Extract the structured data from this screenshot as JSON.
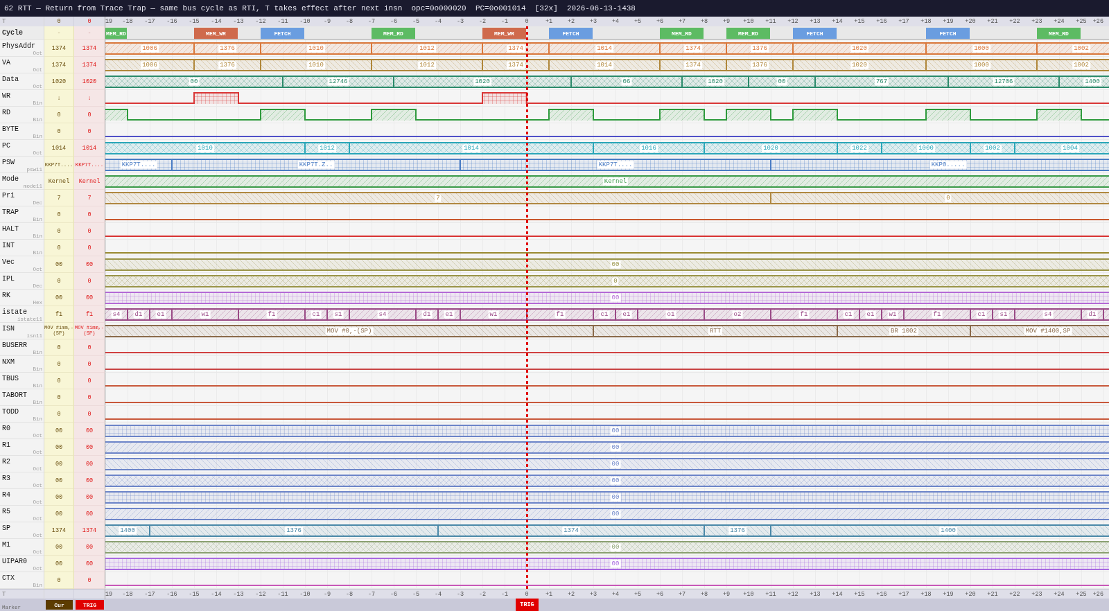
{
  "window": {
    "title": "62 RTT — Return from Trace Trap — same bus cycle as RTI, T takes effect after next insn  opc=0o000020  PC=0o001014  [32x]  2026-06-13-1438"
  },
  "top_axis": {
    "label": "T",
    "cursor_time": "0",
    "trigger_time": "0",
    "ticks": [
      "19",
      "-18",
      "-17",
      "-16",
      "-15",
      "-14",
      "-13",
      "-12",
      "-11",
      "-10",
      "-9",
      "-8",
      "-7",
      "-6",
      "-5",
      "-4",
      "-3",
      "-2",
      "-1",
      "0",
      "+1",
      "+2",
      "+3",
      "+4",
      "+5",
      "+6",
      "+7",
      "+8",
      "+9",
      "+10",
      "+11",
      "+12",
      "+13",
      "+14",
      "+15",
      "+16",
      "+17",
      "+18",
      "+19",
      "+20",
      "+21",
      "+22",
      "+23",
      "+24",
      "+25",
      "+26"
    ]
  },
  "cycle_row": {
    "label": "Cycle",
    "cursor_value": "-",
    "trigger_value": "-",
    "cycles": [
      {
        "label": "MEM_RD",
        "color": "#5dbb63"
      },
      {
        "label": "MEM_WR",
        "color": "#cf6a4c"
      },
      {
        "label": "FETCH",
        "color": "#6a9de0"
      },
      {
        "label": "MEM_RD",
        "color": "#5dbb63"
      },
      {
        "label": "MEM_WR",
        "color": "#cf6a4c"
      },
      {
        "label": "FETCH",
        "color": "#6a9de0"
      },
      {
        "label": "MEM_RD",
        "color": "#5dbb63"
      },
      {
        "label": "MEM_RD",
        "color": "#5dbb63"
      },
      {
        "label": "FETCH",
        "color": "#6a9de0"
      },
      {
        "label": "FETCH",
        "color": "#6a9de0"
      },
      {
        "label": "MEM_RD",
        "color": "#5dbb63"
      }
    ]
  },
  "signals": [
    {
      "name": "PhysAddr",
      "radix": "Oct",
      "kind": "bus",
      "color": "#d9773a",
      "cursor_value": "1374",
      "trigger_value": "1374",
      "segments": [
        {
          "value": "1006"
        },
        {
          "value": "1376"
        },
        {
          "value": "1010"
        },
        {
          "value": "1012"
        },
        {
          "value": "1374"
        },
        {
          "value": "1014"
        },
        {
          "value": "1374"
        },
        {
          "value": "1376"
        },
        {
          "value": "1020"
        },
        {
          "value": "1000"
        },
        {
          "value": "1002"
        }
      ]
    },
    {
      "name": "VA",
      "radix": "Oct",
      "kind": "bus",
      "color": "#b0873a",
      "cursor_value": "1374",
      "trigger_value": "1374",
      "segments": [
        {
          "value": "1006"
        },
        {
          "value": "1376"
        },
        {
          "value": "1010"
        },
        {
          "value": "1012"
        },
        {
          "value": "1374"
        },
        {
          "value": "1014"
        },
        {
          "value": "1374"
        },
        {
          "value": "1376"
        },
        {
          "value": "1020"
        },
        {
          "value": "1000"
        },
        {
          "value": "1002"
        }
      ]
    },
    {
      "name": "Data",
      "radix": "Oct",
      "kind": "bus",
      "color": "#2a8a6a",
      "cursor_value": "1020",
      "trigger_value": "1020",
      "segments": [
        {
          "value": "00"
        },
        {
          "value": "12746"
        },
        {
          "value": "1020"
        },
        {
          "value": "06"
        },
        {
          "value": "1020"
        },
        {
          "value": "00"
        },
        {
          "value": "767"
        },
        {
          "value": "12706"
        },
        {
          "value": "1400"
        }
      ]
    },
    {
      "name": "WR",
      "radix": "Bin",
      "kind": "bit",
      "color": "#d93636",
      "cursor_value": "↓",
      "trigger_value": "↓",
      "segments": [
        {
          "high": false
        },
        {
          "high": true
        },
        {
          "high": false
        },
        {
          "high": true
        },
        {
          "high": false
        }
      ]
    },
    {
      "name": "RD",
      "radix": "Bin",
      "kind": "bit",
      "color": "#2e9a3c",
      "cursor_value": "0",
      "trigger_value": "0",
      "segments": [
        {
          "high": true
        },
        {
          "high": false
        },
        {
          "high": true
        },
        {
          "high": false
        },
        {
          "high": true
        },
        {
          "high": false
        },
        {
          "high": true
        },
        {
          "high": false
        },
        {
          "high": true
        },
        {
          "high": false
        },
        {
          "high": true
        },
        {
          "high": false
        },
        {
          "high": true
        },
        {
          "high": false
        },
        {
          "high": true
        },
        {
          "high": false
        },
        {
          "high": true
        },
        {
          "high": false
        }
      ]
    },
    {
      "name": "BYTE",
      "radix": "Bin",
      "kind": "bit",
      "color": "#5050c8",
      "cursor_value": "0",
      "trigger_value": "0",
      "segments": [
        {
          "high": false
        }
      ]
    },
    {
      "name": "PC",
      "radix": "Oct",
      "kind": "bus",
      "color": "#2aa6b8",
      "cursor_value": "1014",
      "trigger_value": "1014",
      "segments": [
        {
          "value": "1010"
        },
        {
          "value": "1012"
        },
        {
          "value": "1014"
        },
        {
          "value": "1016"
        },
        {
          "value": "1020"
        },
        {
          "value": "1022"
        },
        {
          "value": "1000"
        },
        {
          "value": "1002"
        },
        {
          "value": "1004"
        }
      ]
    },
    {
      "name": "PSW",
      "radix": "psw11",
      "kind": "bus",
      "color": "#4a7cc4",
      "cursor_value": "KKP7T....",
      "trigger_value": "KKP7T....",
      "segments": [
        {
          "value": "KKP7T...."
        },
        {
          "value": "KKP7T.Z.."
        },
        {
          "value": "KKP7T...."
        },
        {
          "value": "KKP0....."
        }
      ]
    },
    {
      "name": "Mode",
      "radix": "mode11",
      "kind": "bus",
      "color": "#3a9a48",
      "cursor_value": "Kernel",
      "trigger_value": "Kernel",
      "segments": [
        {
          "value": "Kernel"
        }
      ]
    },
    {
      "name": "Pri",
      "radix": "Dec",
      "kind": "bus",
      "color": "#b08840",
      "cursor_value": "7",
      "trigger_value": "7",
      "segments": [
        {
          "value": "7"
        },
        {
          "value": "0"
        }
      ]
    },
    {
      "name": "TRAP",
      "radix": "Bin",
      "kind": "bit",
      "color": "#c8582e",
      "cursor_value": "0",
      "trigger_value": "0",
      "segments": [
        {
          "high": false
        }
      ]
    },
    {
      "name": "HALT",
      "radix": "Bin",
      "kind": "bit",
      "color": "#d83232",
      "cursor_value": "0",
      "trigger_value": "0",
      "segments": [
        {
          "high": false
        }
      ]
    },
    {
      "name": "INT",
      "radix": "Bin",
      "kind": "bit",
      "color": "#9a8a30",
      "cursor_value": "0",
      "trigger_value": "0",
      "segments": [
        {
          "high": false
        }
      ]
    },
    {
      "name": "Vec",
      "radix": "Oct",
      "kind": "bus",
      "color": "#9a9448",
      "cursor_value": "00",
      "trigger_value": "00",
      "segments": [
        {
          "value": "00"
        }
      ]
    },
    {
      "name": "IPL",
      "radix": "Dec",
      "kind": "bus",
      "color": "#9a9448",
      "cursor_value": "0",
      "trigger_value": "0",
      "segments": [
        {
          "value": "0"
        }
      ]
    },
    {
      "name": "RK",
      "radix": "Hex",
      "kind": "bus",
      "color": "#b46ad6",
      "cursor_value": "00",
      "trigger_value": "00",
      "segments": [
        {
          "value": "00"
        }
      ]
    },
    {
      "name": "istate",
      "radix": "istate11",
      "kind": "bus",
      "color": "#9a4a86",
      "cursor_value": "f1",
      "trigger_value": "f1",
      "segments": [
        {
          "value": "s4"
        },
        {
          "value": "d1"
        },
        {
          "value": "e1"
        },
        {
          "value": "w1"
        },
        {
          "value": "f1"
        },
        {
          "value": "c1"
        },
        {
          "value": "s1"
        },
        {
          "value": "s4"
        },
        {
          "value": "d1"
        },
        {
          "value": "e1"
        },
        {
          "value": "w1"
        },
        {
          "value": "f1"
        },
        {
          "value": "c1"
        },
        {
          "value": "e1"
        },
        {
          "value": "o1"
        },
        {
          "value": "o2"
        },
        {
          "value": "f1"
        },
        {
          "value": "c1"
        },
        {
          "value": "e1"
        },
        {
          "value": "w1"
        },
        {
          "value": "f1"
        },
        {
          "value": "c1"
        },
        {
          "value": "s1"
        },
        {
          "value": "s4"
        },
        {
          "value": "d1"
        }
      ]
    },
    {
      "name": "ISN",
      "radix": "isn11",
      "kind": "bus",
      "color": "#8a6a4a",
      "cursor_value": "MOV #imm,-(SP)",
      "trigger_value": "MOV #imm,-(SP)",
      "segments": [
        {
          "value": "MOV #0,-(SP)"
        },
        {
          "value": "RTT"
        },
        {
          "value": "BR 1002"
        },
        {
          "value": "MOV #1400,SP"
        }
      ]
    },
    {
      "name": "BUSERR",
      "radix": "Bin",
      "kind": "bit",
      "color": "#d04040",
      "cursor_value": "0",
      "trigger_value": "0",
      "segments": [
        {
          "high": false
        }
      ]
    },
    {
      "name": "NXM",
      "radix": "Bin",
      "kind": "bit",
      "color": "#c84444",
      "cursor_value": "0",
      "trigger_value": "0",
      "segments": [
        {
          "high": false
        }
      ]
    },
    {
      "name": "TBUS",
      "radix": "Bin",
      "kind": "bit",
      "color": "#c8583a",
      "cursor_value": "0",
      "trigger_value": "0",
      "segments": [
        {
          "high": false
        }
      ]
    },
    {
      "name": "TABORT",
      "radix": "Bin",
      "kind": "bit",
      "color": "#c8583a",
      "cursor_value": "0",
      "trigger_value": "0",
      "segments": [
        {
          "high": false
        }
      ]
    },
    {
      "name": "TODD",
      "radix": "Bin",
      "kind": "bit",
      "color": "#c8583a",
      "cursor_value": "0",
      "trigger_value": "0",
      "segments": [
        {
          "high": false
        }
      ]
    },
    {
      "name": "R0",
      "radix": "Oct",
      "kind": "bus",
      "color": "#6c84c8",
      "cursor_value": "00",
      "trigger_value": "00",
      "segments": [
        {
          "value": "00"
        }
      ]
    },
    {
      "name": "R1",
      "radix": "Oct",
      "kind": "bus",
      "color": "#6c84c8",
      "cursor_value": "00",
      "trigger_value": "00",
      "segments": [
        {
          "value": "00"
        }
      ]
    },
    {
      "name": "R2",
      "radix": "Oct",
      "kind": "bus",
      "color": "#6c84c8",
      "cursor_value": "00",
      "trigger_value": "00",
      "segments": [
        {
          "value": "00"
        }
      ]
    },
    {
      "name": "R3",
      "radix": "Oct",
      "kind": "bus",
      "color": "#6c84c8",
      "cursor_value": "00",
      "trigger_value": "00",
      "segments": [
        {
          "value": "00"
        }
      ]
    },
    {
      "name": "R4",
      "radix": "Oct",
      "kind": "bus",
      "color": "#6c84c8",
      "cursor_value": "00",
      "trigger_value": "00",
      "segments": [
        {
          "value": "00"
        }
      ]
    },
    {
      "name": "R5",
      "radix": "Oct",
      "kind": "bus",
      "color": "#6c84c8",
      "cursor_value": "00",
      "trigger_value": "00",
      "segments": [
        {
          "value": "00"
        }
      ]
    },
    {
      "name": "SP",
      "radix": "Oct",
      "kind": "bus",
      "color": "#4a88a8",
      "cursor_value": "1374",
      "trigger_value": "1374",
      "segments": [
        {
          "value": "1400"
        },
        {
          "value": "1376"
        },
        {
          "value": "1374"
        },
        {
          "value": "1376"
        },
        {
          "value": "1400"
        }
      ]
    },
    {
      "name": "M1",
      "radix": "Oct",
      "kind": "bus",
      "color": "#8aa070",
      "cursor_value": "00",
      "trigger_value": "00",
      "segments": [
        {
          "value": "00"
        }
      ]
    },
    {
      "name": "UIPAR0",
      "radix": "Oct",
      "kind": "bus",
      "color": "#a868e0",
      "cursor_value": "00",
      "trigger_value": "00",
      "segments": [
        {
          "value": "00"
        }
      ]
    },
    {
      "name": "CTX",
      "radix": "Bin",
      "kind": "bit",
      "color": "#c858b8",
      "cursor_value": "0",
      "trigger_value": "0",
      "segments": [
        {
          "high": false
        }
      ]
    }
  ],
  "bottom_axis": {
    "label": "T",
    "ticks": [
      "19",
      "-18",
      "-17",
      "-16",
      "-15",
      "-14",
      "-13",
      "-12",
      "-11",
      "-10",
      "-9",
      "-8",
      "-7",
      "-6",
      "-5",
      "-4",
      "-3",
      "-2",
      "-1",
      "0",
      "+1",
      "+2",
      "+3",
      "+4",
      "+5",
      "+6",
      "+7",
      "+8",
      "+9",
      "+10",
      "+11",
      "+12",
      "+13",
      "+14",
      "+15",
      "+16",
      "+17",
      "+18",
      "+19",
      "+20",
      "+21",
      "+22",
      "+23",
      "+24",
      "+25",
      "+26"
    ]
  },
  "marker_bar": {
    "label": "Marker",
    "tags": [
      {
        "label": "Cur",
        "color": "#5c3c00"
      },
      {
        "label": "TRIG",
        "color": "#e00000"
      }
    ],
    "flags": [
      {
        "label": "TRIG",
        "color": "#e00000"
      }
    ]
  }
}
